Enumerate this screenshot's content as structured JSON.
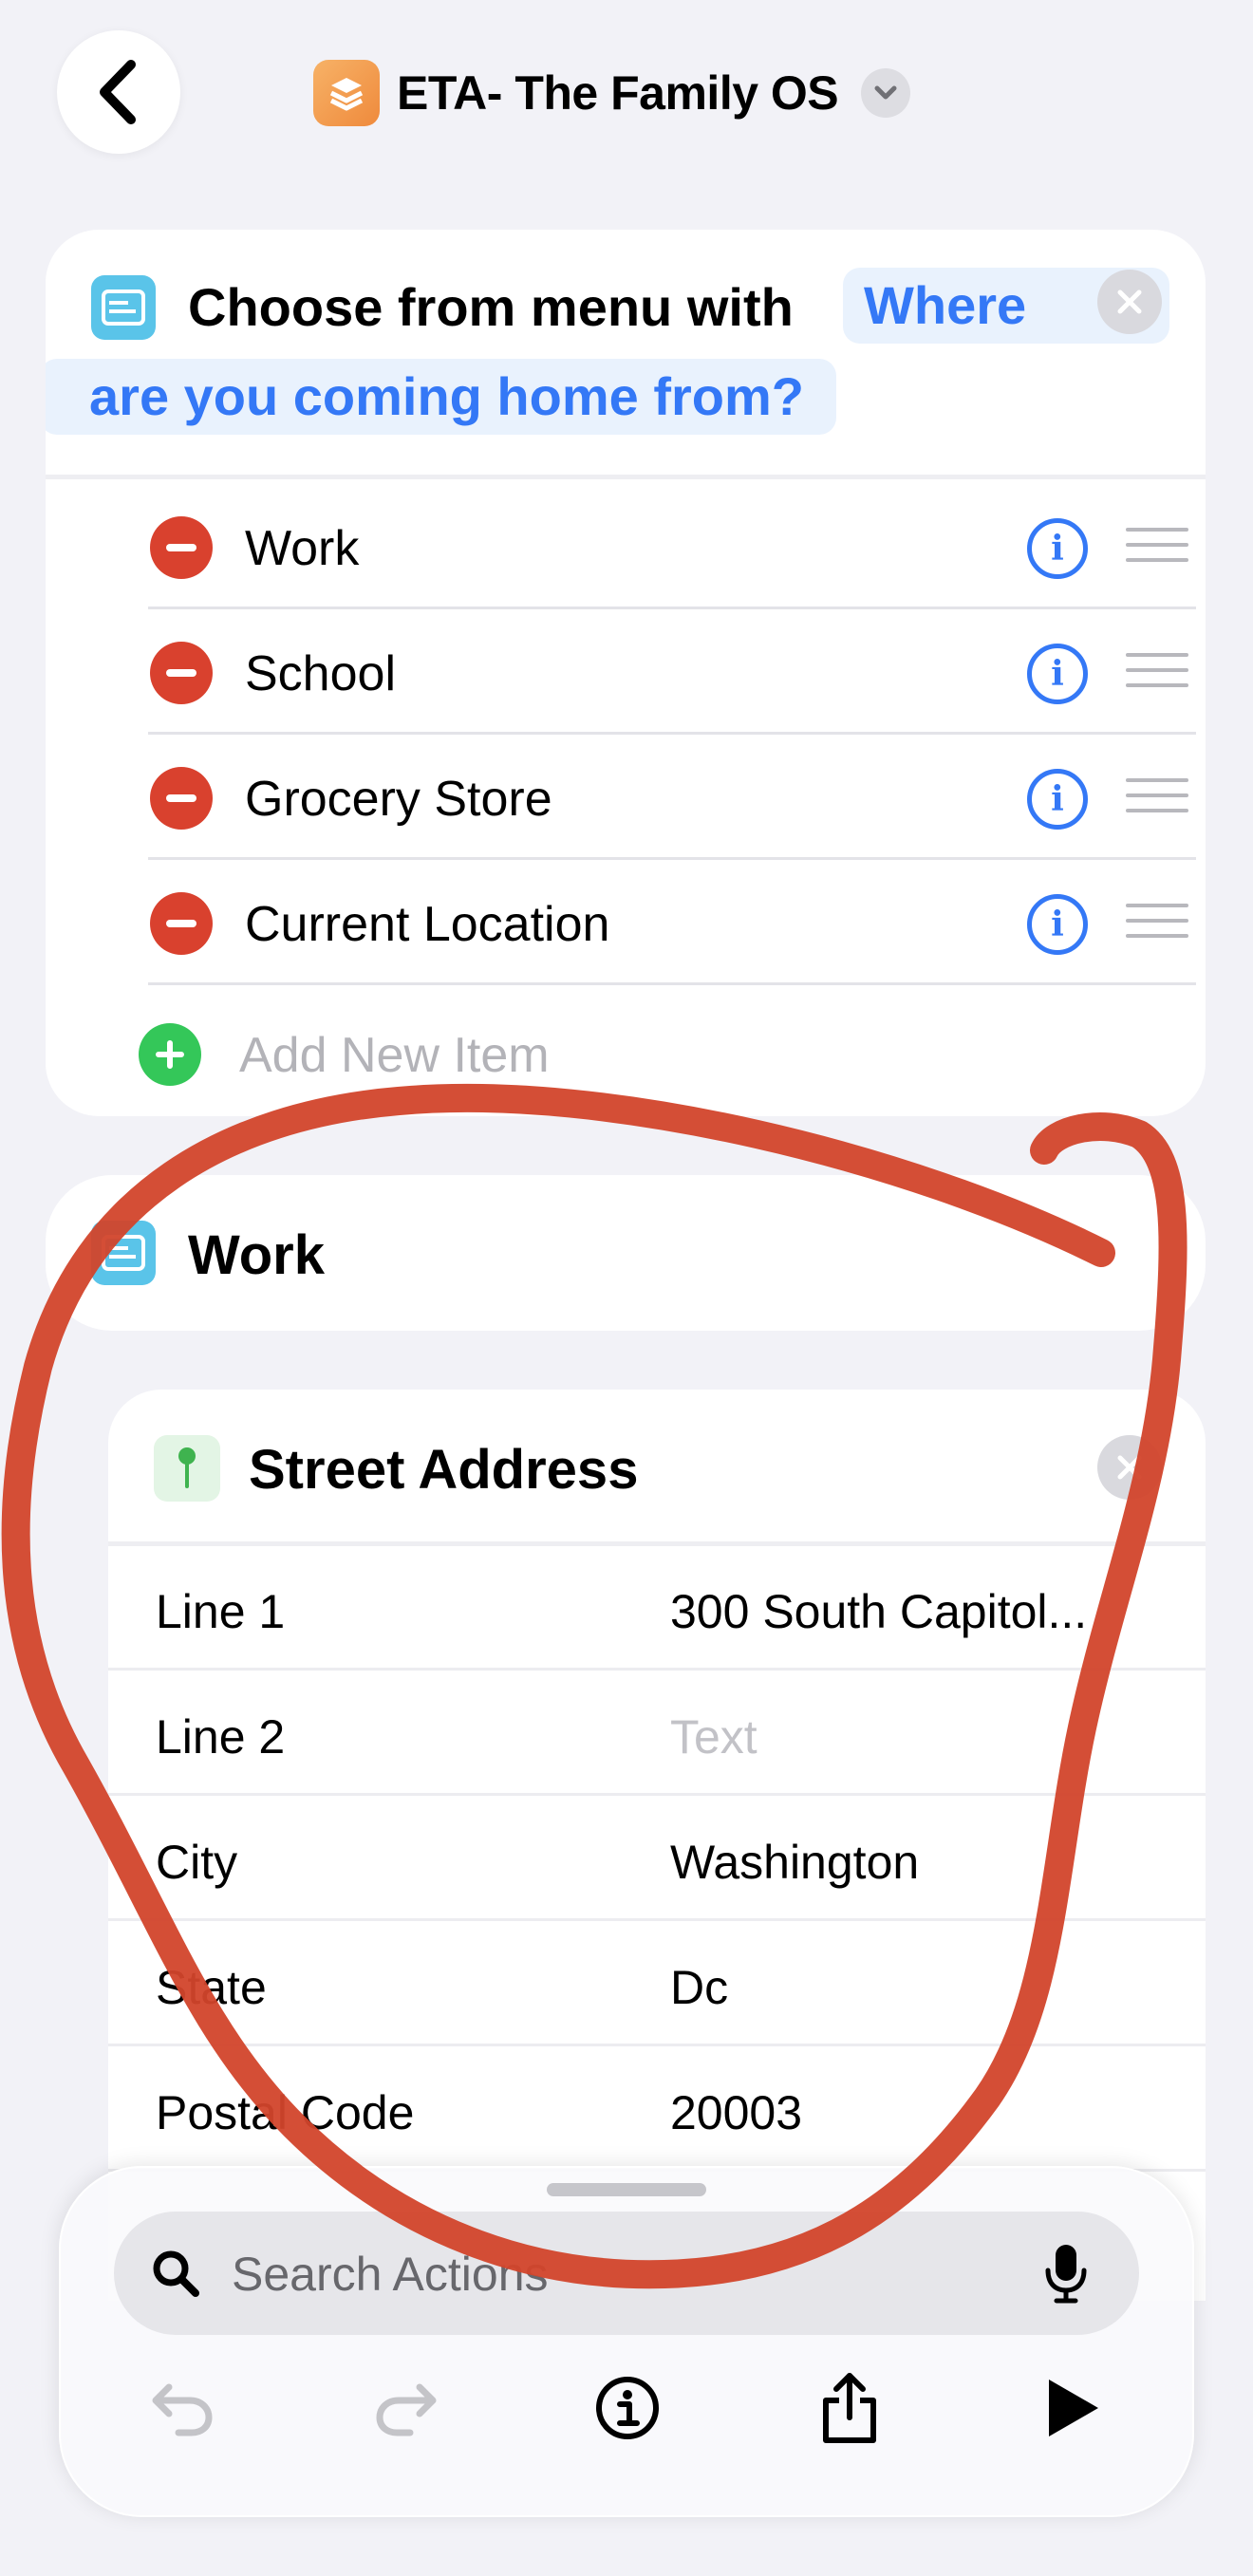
{
  "header": {
    "title": "ETA- The Family OS"
  },
  "menu_action": {
    "prompt_prefix": "Choose from menu with",
    "prompt_token_line1": "Where",
    "prompt_token_line2": "are you coming home from?",
    "items": [
      {
        "label": "Work"
      },
      {
        "label": "School"
      },
      {
        "label": "Grocery Store"
      },
      {
        "label": "Current Location"
      }
    ],
    "add_item_label": "Add New Item"
  },
  "case_block": {
    "label": "Work"
  },
  "address_action": {
    "title": "Street Address",
    "fields": [
      {
        "key": "Line 1",
        "value": "300 South Capitol...",
        "placeholder": false
      },
      {
        "key": "Line 2",
        "value": "Text",
        "placeholder": true
      },
      {
        "key": "City",
        "value": "Washington",
        "placeholder": false
      },
      {
        "key": "State",
        "value": "Dc",
        "placeholder": false
      },
      {
        "key": "Postal Code",
        "value": "20003",
        "placeholder": false
      }
    ]
  },
  "bottom_bar": {
    "search_placeholder": "Search Actions"
  },
  "colors": {
    "accent": "#3478f6",
    "remove": "#d9412e",
    "add": "#34c759",
    "annotation": "#d2442b",
    "background": "#f2f2f7"
  }
}
